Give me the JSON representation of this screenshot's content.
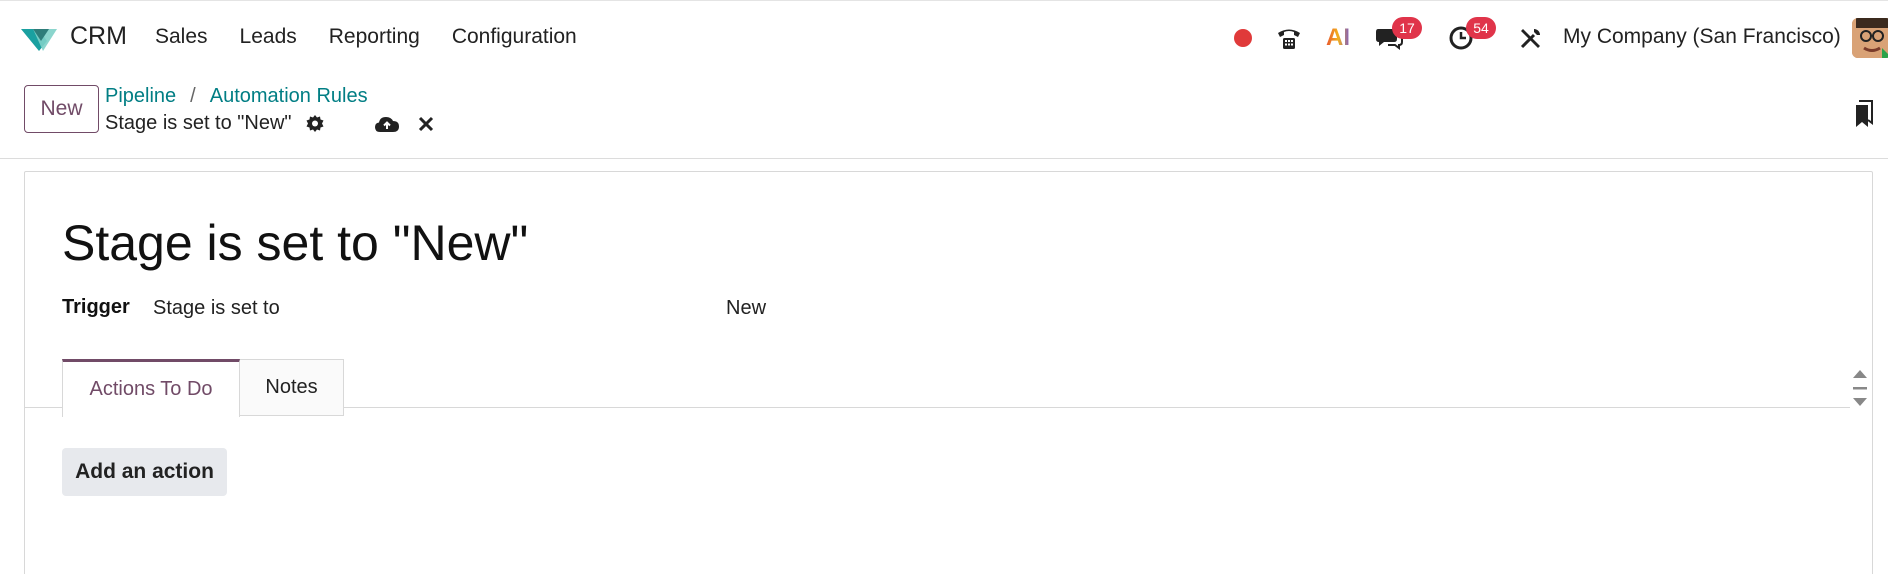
{
  "navbar": {
    "app_name": "CRM",
    "menu": [
      "Sales",
      "Leads",
      "Reporting",
      "Configuration"
    ],
    "ai_label": "AI",
    "messages_count": "17",
    "activities_count": "54",
    "company": "My Company (San Francisco)"
  },
  "control_panel": {
    "new_label": "New",
    "breadcrumbs": [
      "Pipeline",
      "Automation Rules"
    ],
    "breadcrumb_separator": "/",
    "record_title": "Stage is set to \"New\""
  },
  "form": {
    "title": "Stage is set to \"New\"",
    "trigger_label": "Trigger",
    "trigger_value": "Stage is set to",
    "trigger_stage": "New",
    "tabs": [
      "Actions To Do",
      "Notes"
    ],
    "add_action_label": "Add an action"
  },
  "colors": {
    "brand": "#714b67",
    "link": "#017e84",
    "badge": "#e0344a",
    "recording": "#e03a3a"
  }
}
